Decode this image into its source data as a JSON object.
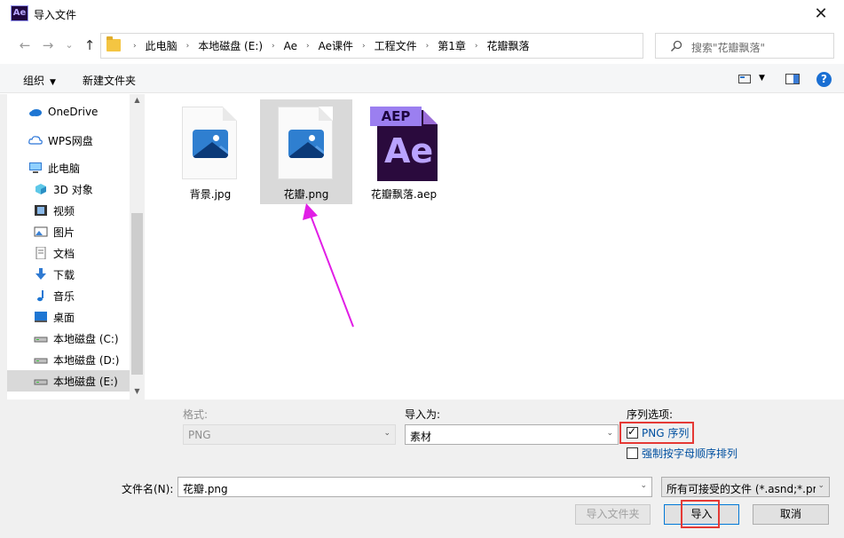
{
  "window": {
    "app_icon_text": "Ae",
    "title": "导入文件",
    "close_glyph": "✕"
  },
  "nav": {
    "back_glyph": "←",
    "forward_glyph": "→",
    "recent_glyph": "⌄",
    "up_glyph": "↑",
    "breadcrumbs": [
      "此电脑",
      "本地磁盘 (E:)",
      "Ae",
      "Ae课件",
      "工程文件",
      "第1章",
      "花瓣飘落"
    ],
    "crumb_separator": "›",
    "address_dropdown_glyph": "⌄",
    "refresh_glyph": "↻",
    "search_placeholder": "搜索\"花瓣飘落\""
  },
  "toolbar": {
    "organize_label": "组织",
    "organize_caret": "▼",
    "new_folder_label": "新建文件夹",
    "view_caret": "▼",
    "help_glyph": "?"
  },
  "sidebar": {
    "items": [
      {
        "label": "OneDrive",
        "icon": "cloud-icon"
      },
      {
        "label": "WPS网盘",
        "icon": "wps-cloud-icon"
      },
      {
        "label": "此电脑",
        "icon": "computer-icon"
      },
      {
        "label": "3D 对象",
        "icon": "3d-objects-icon"
      },
      {
        "label": "视频",
        "icon": "video-icon"
      },
      {
        "label": "图片",
        "icon": "pictures-icon"
      },
      {
        "label": "文档",
        "icon": "documents-icon"
      },
      {
        "label": "下载",
        "icon": "download-icon"
      },
      {
        "label": "音乐",
        "icon": "music-icon"
      },
      {
        "label": "桌面",
        "icon": "desktop-icon"
      },
      {
        "label": "本地磁盘 (C:)",
        "icon": "drive-icon"
      },
      {
        "label": "本地磁盘 (D:)",
        "icon": "drive-icon"
      },
      {
        "label": "本地磁盘 (E:)",
        "icon": "drive-icon"
      }
    ],
    "selected_index": 12,
    "scroll_up_glyph": "▲",
    "scroll_down_glyph": "▼"
  },
  "files": [
    {
      "name": "背景.jpg",
      "type": "image"
    },
    {
      "name": "花瓣.png",
      "type": "image",
      "selected": true
    },
    {
      "name": "花瓣飘落.aep",
      "type": "aep"
    }
  ],
  "aep_icon": {
    "tag": "AEP",
    "letters": "Ae"
  },
  "options": {
    "format_label": "格式:",
    "format_value": "PNG",
    "import_as_label": "导入为:",
    "import_as_value": "素材",
    "sequence_label": "序列选项:",
    "png_sequence_label": "PNG 序列",
    "png_sequence_checked": true,
    "force_alpha_label": "强制按字母顺序排列",
    "force_alpha_checked": false,
    "combo_caret": "⌄"
  },
  "filename": {
    "label": "文件名(N):",
    "value": "花瓣.png",
    "filter_value": "所有可接受的文件 (*.asnd;*.pr"
  },
  "buttons": {
    "import_folder": "导入文件夹",
    "import": "导入",
    "cancel": "取消"
  },
  "colors": {
    "annotation_arrow": "#e11ee6",
    "highlight_box": "#e53935",
    "accent": "#0078d7"
  }
}
